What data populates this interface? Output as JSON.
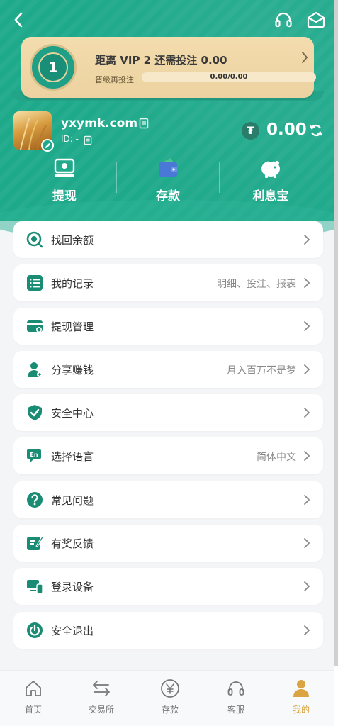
{
  "header": {
    "vip": {
      "title_prefix": "距离",
      "level_label": "VIP 2",
      "title_suffix": "还需投注 0.00",
      "medal_number": "1",
      "progress_label": "晋级再投注",
      "progress_text": "0.00/0.00",
      "progress_fraction": 0
    },
    "profile": {
      "username": "yxymk.com",
      "id_text": "ID: -",
      "currency_symbol": "₮",
      "balance": "0.00"
    },
    "actions": [
      {
        "label": "提现",
        "icon": "withdraw-icon"
      },
      {
        "label": "存款",
        "icon": "wallet-icon"
      },
      {
        "label": "利息宝",
        "icon": "piggy-bank-icon"
      }
    ]
  },
  "menu": [
    {
      "label": "找回余额",
      "value": "",
      "icon": "search-coin-icon"
    },
    {
      "label": "我的记录",
      "value": "明细、投注、报表",
      "icon": "list-icon"
    },
    {
      "label": "提现管理",
      "value": "",
      "icon": "card-settings-icon"
    },
    {
      "label": "分享赚钱",
      "value": "月入百万不是梦",
      "icon": "share-user-icon"
    },
    {
      "label": "安全中心",
      "value": "",
      "icon": "shield-check-icon"
    },
    {
      "label": "选择语言",
      "value": "简体中文",
      "icon": "language-icon"
    },
    {
      "label": "常见问题",
      "value": "",
      "icon": "question-icon"
    },
    {
      "label": "有奖反馈",
      "value": "",
      "icon": "feedback-icon"
    },
    {
      "label": "登录设备",
      "value": "",
      "icon": "devices-icon"
    },
    {
      "label": "安全退出",
      "value": "",
      "icon": "power-icon"
    }
  ],
  "nav": [
    {
      "label": "首页",
      "icon": "home-icon",
      "active": false
    },
    {
      "label": "交易所",
      "icon": "exchange-icon",
      "active": false
    },
    {
      "label": "存款",
      "icon": "yen-icon",
      "active": false
    },
    {
      "label": "客服",
      "icon": "headset-icon",
      "active": false
    },
    {
      "label": "我的",
      "icon": "user-icon",
      "active": true
    }
  ],
  "colors": {
    "brand": "#1fa98b",
    "icon": "#1a8c74",
    "active_nav": "#d9a441",
    "vip_gold": "#f3dcae"
  }
}
